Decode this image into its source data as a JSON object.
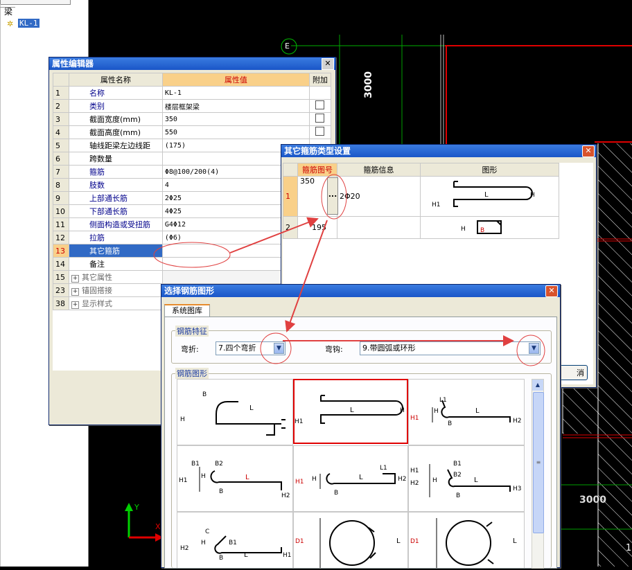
{
  "tree": {
    "root_label": "梁",
    "child_label": "KL-1"
  },
  "cad": {
    "axis_label": "E",
    "dim_top": "3000",
    "dim_right": "3000",
    "ucs_y": "Y",
    "ucs_x": "X",
    "corner": "1"
  },
  "prop_editor": {
    "title": "属性编辑器",
    "headers": [
      "属性名称",
      "属性值",
      "附加"
    ],
    "rows": [
      {
        "num": "1",
        "name": "名称",
        "value": "KL-1",
        "check": false
      },
      {
        "num": "2",
        "name": "类别",
        "value": "楼层框架梁",
        "check": true
      },
      {
        "num": "3",
        "name": "截面宽度(mm)",
        "value": "350",
        "check": true
      },
      {
        "num": "4",
        "name": "截面高度(mm)",
        "value": "550",
        "check": true
      },
      {
        "num": "5",
        "name": "轴线距梁左边线距",
        "value": "(175)",
        "check": false
      },
      {
        "num": "6",
        "name": "跨数量",
        "value": "",
        "check": false
      },
      {
        "num": "7",
        "name": "箍筋",
        "value": "Φ8@100/200(4)",
        "check": false
      },
      {
        "num": "8",
        "name": "肢数",
        "value": "4",
        "check": false
      },
      {
        "num": "9",
        "name": "上部通长筋",
        "value": "2Φ25",
        "check": false
      },
      {
        "num": "10",
        "name": "下部通长筋",
        "value": "4Φ25",
        "check": false
      },
      {
        "num": "11",
        "name": "侧面构造或受扭筋",
        "value": "G4Φ12",
        "check": false
      },
      {
        "num": "12",
        "name": "拉筋",
        "value": "(Φ6)",
        "check": false
      },
      {
        "num": "13",
        "name": "其它箍筋",
        "value": "",
        "check": false
      },
      {
        "num": "14",
        "name": "备注",
        "value": "",
        "check": false
      },
      {
        "num": "15",
        "name": "其它属性",
        "value": "",
        "check": false
      },
      {
        "num": "23",
        "name": "锚固搭接",
        "value": "",
        "check": false
      },
      {
        "num": "38",
        "name": "显示样式",
        "value": "",
        "check": false
      }
    ]
  },
  "stirrup_dialog": {
    "title": "其它箍筋类型设置",
    "headers": [
      "箍筋图号",
      "箍筋信息",
      "图形"
    ],
    "row1": {
      "num": "1",
      "code": "350",
      "btn": "...",
      "info": "2Φ20"
    },
    "row2": {
      "num": "2",
      "code": "195"
    },
    "cancel_label": "消",
    "shape_labels": {
      "L": "L",
      "H": "H",
      "H1": "H1",
      "B": "B"
    }
  },
  "shape_dialog": {
    "title": "选择钢筋图形",
    "tab": "系统图库",
    "group1": "钢筋特征",
    "bend_label": "弯折:",
    "bend_value": "7.四个弯折",
    "hook_label": "弯钩:",
    "hook_value": "9.带圆弧或环形",
    "group2": "钢筋图形",
    "labels": {
      "L": "L",
      "H": "H",
      "H1": "H1",
      "H2": "H2",
      "H3": "H3",
      "B": "B",
      "B1": "B1",
      "B2": "B2",
      "L1": "L1",
      "C": "C",
      "D1": "D1"
    }
  }
}
